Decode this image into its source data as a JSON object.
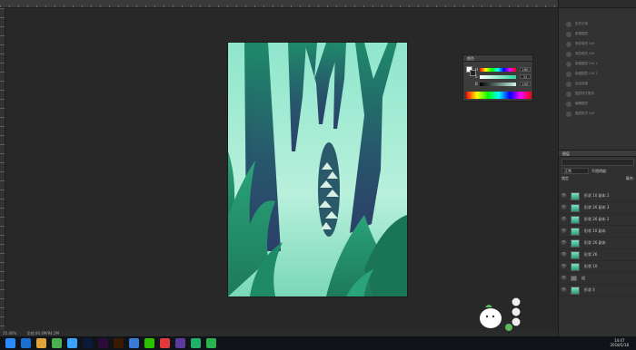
{
  "statusbar": {
    "zoom": "25.46%",
    "doc": "文档:46.4M/94.2M"
  },
  "history_panel": {
    "items": [
      "历史记录",
      "新建图层",
      "渐变填充 Ctrl",
      "渐变填充 Ctrl",
      "新建图层 Ctrl 2",
      "新建图层 Ctrl 2",
      "自由变换",
      "图层样式更改",
      "编辑图层",
      "图层样式 Ctrl"
    ]
  },
  "color_panel": {
    "title": "颜色",
    "h_label": "H",
    "h_value": "160",
    "s_label": "S",
    "s_value": "31",
    "b_label": "B",
    "b_value": "100"
  },
  "layers_panel": {
    "title": "图层",
    "mode": "正常",
    "opacity_label": "不透明度:",
    "lock_label": "锁定",
    "fill_label": "填充:",
    "layers": [
      "形状 10 副本 2",
      "形状 26 副本 3",
      "形状 26 副本 2",
      "形状 10 副本",
      "形状 26 副本",
      "形状 26",
      "形状 10",
      "组",
      "形状 4"
    ]
  },
  "taskbar": {
    "icons": [
      "win",
      "ie",
      "folder",
      "chrome",
      "qq",
      "ps",
      "pr",
      "ai",
      "browser",
      "wechat",
      "rec",
      "ae",
      "cam",
      "wps"
    ],
    "icon_colors": [
      "#2a8cff",
      "#1c6fd0",
      "#e0a33a",
      "#4caf50",
      "#3ba3ff",
      "#0b1a3a",
      "#2c0a3a",
      "#3a1a00",
      "#3a7bd5",
      "#2dc100",
      "#e03a3a",
      "#5c3a9c",
      "#1fb06a",
      "#2bb34f"
    ],
    "time": "14:47",
    "date": "2018/5/18"
  },
  "colors": {
    "accent": "#2a9c7a",
    "bg": "#282828"
  }
}
